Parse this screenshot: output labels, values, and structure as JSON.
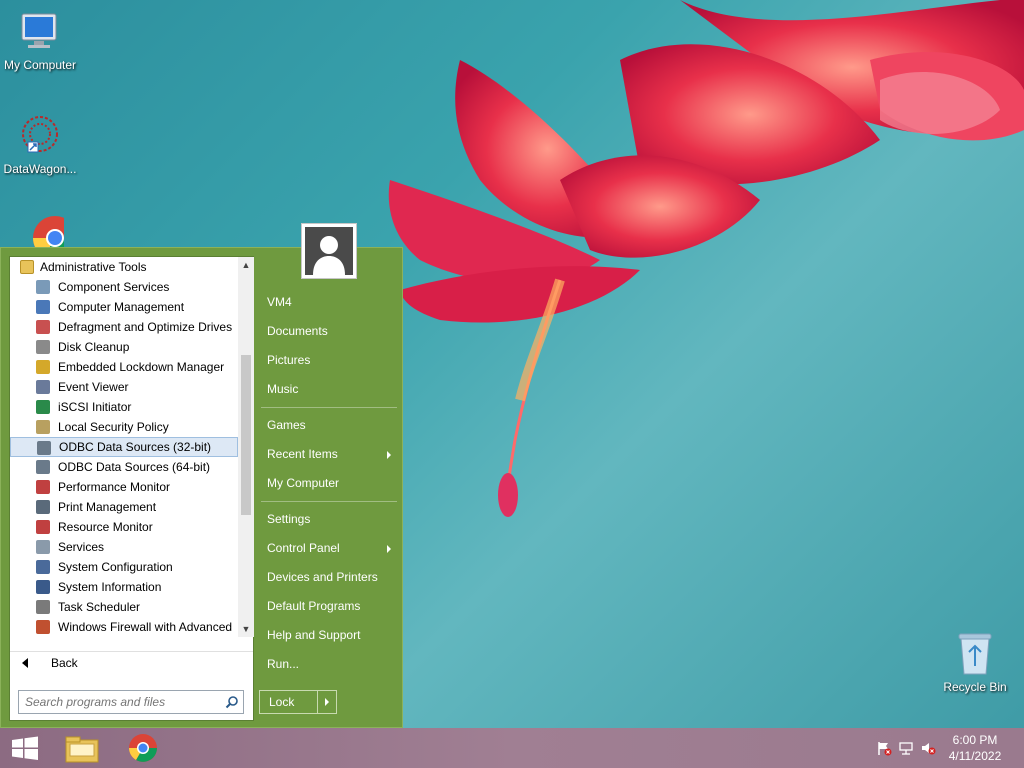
{
  "desktop": {
    "icons": [
      {
        "label": "My Computer"
      },
      {
        "label": "DataWagon..."
      },
      {
        "label": "Recycle Bin"
      }
    ]
  },
  "start_menu": {
    "folder": "Administrative Tools",
    "programs": [
      {
        "label": "Component Services",
        "icon": "component-services-icon",
        "color": "#7a9ab8"
      },
      {
        "label": "Computer Management",
        "icon": "computer-management-icon",
        "color": "#4a78b8"
      },
      {
        "label": "Defragment and Optimize Drives",
        "icon": "defrag-icon",
        "color": "#c85050"
      },
      {
        "label": "Disk Cleanup",
        "icon": "disk-cleanup-icon",
        "color": "#8a8a8a"
      },
      {
        "label": "Embedded Lockdown Manager",
        "icon": "lock-icon",
        "color": "#d4a82a"
      },
      {
        "label": "Event Viewer",
        "icon": "event-viewer-icon",
        "color": "#6a7a9a"
      },
      {
        "label": "iSCSI Initiator",
        "icon": "globe-icon",
        "color": "#2a8a4a"
      },
      {
        "label": "Local Security Policy",
        "icon": "security-policy-icon",
        "color": "#b8a060"
      },
      {
        "label": "ODBC Data Sources (32-bit)",
        "icon": "odbc-icon",
        "color": "#6a7a8a"
      },
      {
        "label": "ODBC Data Sources (64-bit)",
        "icon": "odbc-icon",
        "color": "#6a7a8a"
      },
      {
        "label": "Performance Monitor",
        "icon": "performance-monitor-icon",
        "color": "#c04040"
      },
      {
        "label": "Print Management",
        "icon": "printer-icon",
        "color": "#5a6a7a"
      },
      {
        "label": "Resource Monitor",
        "icon": "resource-monitor-icon",
        "color": "#c04040"
      },
      {
        "label": "Services",
        "icon": "gear-icon",
        "color": "#8a9aaa"
      },
      {
        "label": "System Configuration",
        "icon": "system-config-icon",
        "color": "#4a6a9a"
      },
      {
        "label": "System Information",
        "icon": "system-info-icon",
        "color": "#3a5a8a"
      },
      {
        "label": "Task Scheduler",
        "icon": "clock-icon",
        "color": "#7a7a7a"
      },
      {
        "label": "Windows Firewall with Advanced",
        "icon": "firewall-icon",
        "color": "#c05030"
      }
    ],
    "selected_index": 8,
    "back_label": "Back",
    "search_placeholder": "Search programs and files",
    "right_items_group1": [
      {
        "label": "VM4",
        "has_arrow": false
      },
      {
        "label": "Documents",
        "has_arrow": false
      },
      {
        "label": "Pictures",
        "has_arrow": false
      },
      {
        "label": "Music",
        "has_arrow": false
      }
    ],
    "right_items_group2": [
      {
        "label": "Games",
        "has_arrow": false
      },
      {
        "label": "Recent Items",
        "has_arrow": true
      },
      {
        "label": "My Computer",
        "has_arrow": false
      }
    ],
    "right_items_group3": [
      {
        "label": "Settings",
        "has_arrow": false
      },
      {
        "label": "Control Panel",
        "has_arrow": true
      },
      {
        "label": "Devices and Printers",
        "has_arrow": false
      },
      {
        "label": "Default Programs",
        "has_arrow": false
      },
      {
        "label": "Help and Support",
        "has_arrow": false
      },
      {
        "label": "Run...",
        "has_arrow": false
      }
    ],
    "lock_label": "Lock"
  },
  "taskbar": {
    "clock_time": "6:00 PM",
    "clock_date": "4/11/2022"
  }
}
